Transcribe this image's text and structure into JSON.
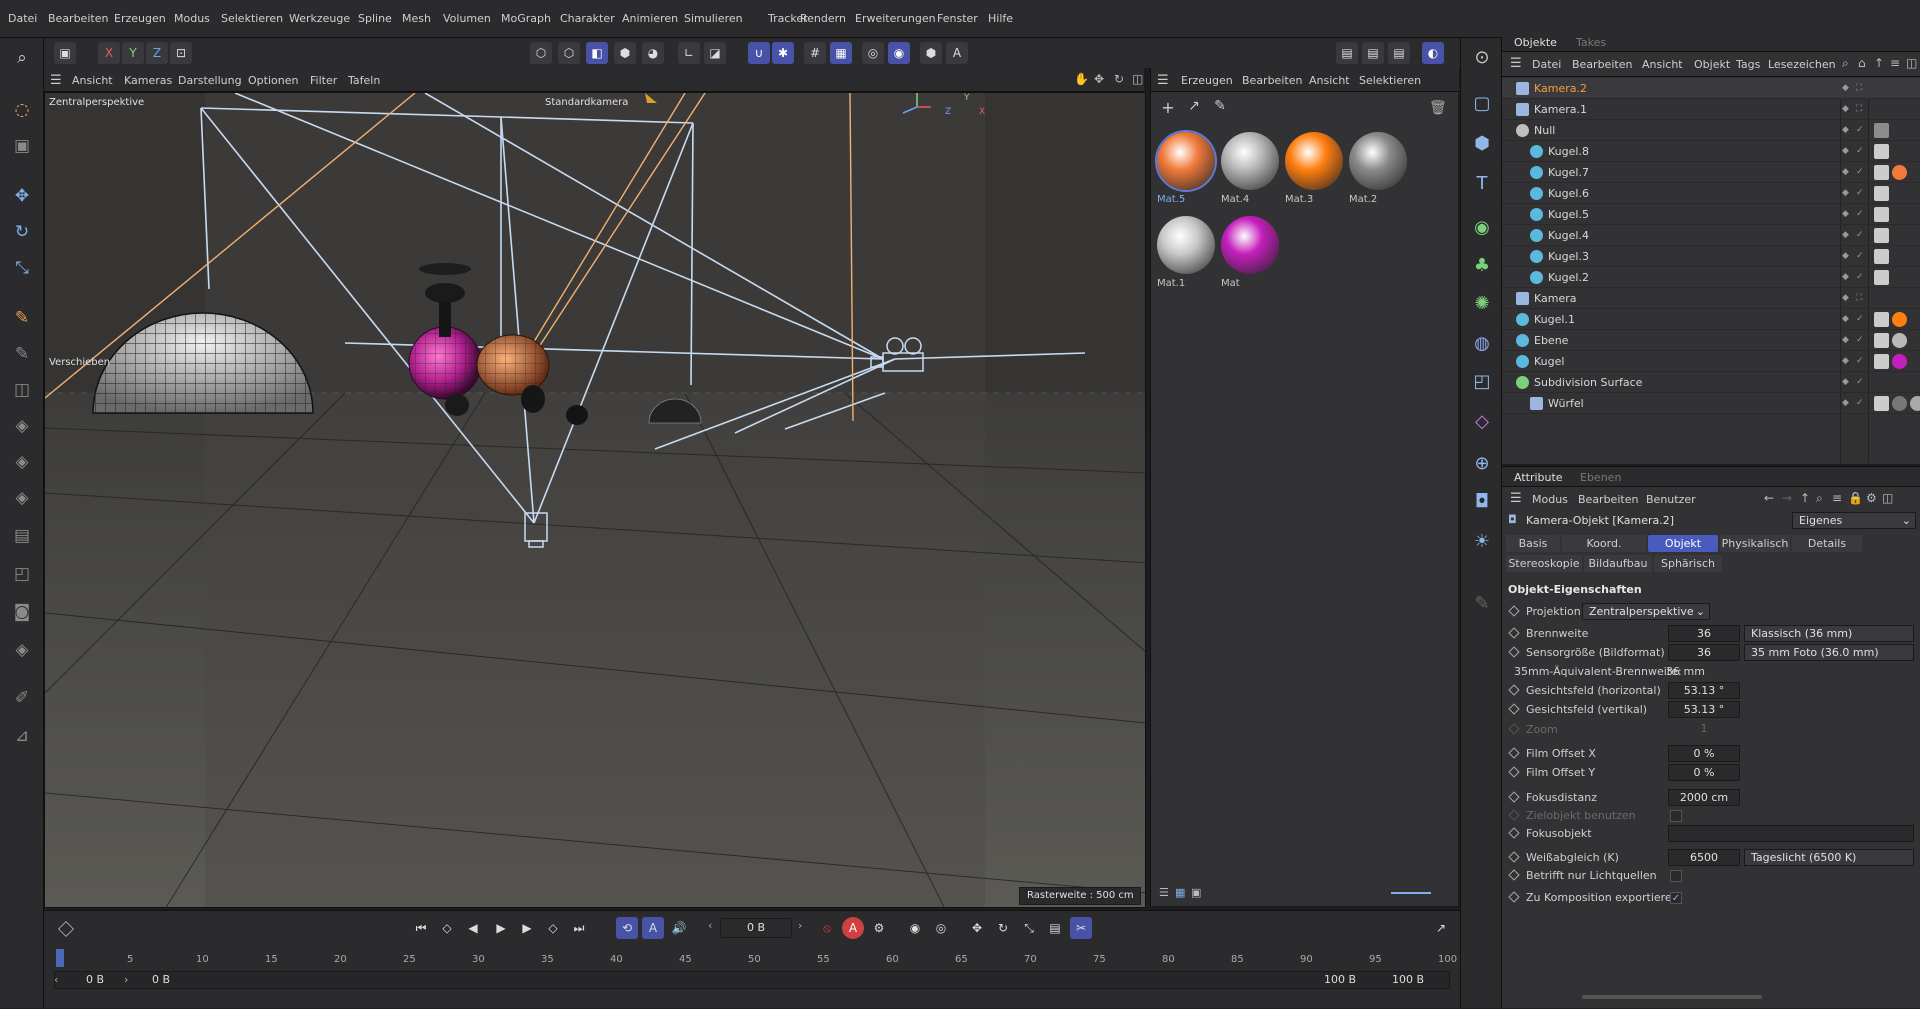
{
  "menubar": [
    "Datei",
    "Bearbeiten",
    "Erzeugen",
    "Modus",
    "Selektieren",
    "Werkzeuge",
    "Spline",
    "Mesh",
    "Volumen",
    "MoGraph",
    "Charakter",
    "Animieren",
    "Simulieren",
    "Tracker",
    "Rendern",
    "Erweiterungen",
    "Fenster",
    "Hilfe"
  ],
  "axis_buttons": [
    "X",
    "Y",
    "Z"
  ],
  "viewport": {
    "menu": [
      "Ansicht",
      "Kameras",
      "Darstellung",
      "Optionen",
      "Filter",
      "Tafeln"
    ],
    "projection_label": "Zentralperspektive",
    "camera_label": "Standardkamera",
    "tool_label": "Verschieben",
    "grid_label": "Rasterweite : 500 cm",
    "axis": {
      "x": "X",
      "y": "Y",
      "z": "Z"
    }
  },
  "materials": {
    "menu": [
      "Erzeugen",
      "Bearbeiten",
      "Ansicht",
      "Selektieren"
    ],
    "items": [
      {
        "name": "Mat.5",
        "color": "#f07a3a",
        "active": true
      },
      {
        "name": "Mat.4",
        "color": "#b8b8b8",
        "active": false
      },
      {
        "name": "Mat.3",
        "color": "#ff7e10",
        "active": false
      },
      {
        "name": "Mat.2",
        "color": "#8a8a8a",
        "active": false
      },
      {
        "name": "Mat.1",
        "color": "#c8c8c8",
        "active": false
      },
      {
        "name": "Mat",
        "color": "#c41fbc",
        "active": false
      }
    ]
  },
  "objects": {
    "tabs": [
      "Objekte",
      "Takes"
    ],
    "menu": [
      "Datei",
      "Bearbeiten",
      "Ansicht",
      "Objekt",
      "Tags",
      "Lesezeichen"
    ],
    "rows": [
      {
        "name": "Kamera.2",
        "indent": 0,
        "kind": "camera",
        "selected": true,
        "tags": []
      },
      {
        "name": "Kamera.1",
        "indent": 0,
        "kind": "camera",
        "selected": false,
        "tags": []
      },
      {
        "name": "Null",
        "indent": 0,
        "kind": "null",
        "selected": false,
        "tags": [
          "#8c8c8c"
        ]
      },
      {
        "name": "Kugel.8",
        "indent": 1,
        "kind": "sphere",
        "selected": false,
        "tags": [
          "#cccccc"
        ]
      },
      {
        "name": "Kugel.7",
        "indent": 1,
        "kind": "sphere",
        "selected": false,
        "tags": [
          "#cccccc",
          "#f07a3a"
        ]
      },
      {
        "name": "Kugel.6",
        "indent": 1,
        "kind": "sphere",
        "selected": false,
        "tags": [
          "#cccccc"
        ]
      },
      {
        "name": "Kugel.5",
        "indent": 1,
        "kind": "sphere",
        "selected": false,
        "tags": [
          "#cccccc"
        ]
      },
      {
        "name": "Kugel.4",
        "indent": 1,
        "kind": "sphere",
        "selected": false,
        "tags": [
          "#cccccc"
        ]
      },
      {
        "name": "Kugel.3",
        "indent": 1,
        "kind": "sphere",
        "selected": false,
        "tags": [
          "#cccccc"
        ]
      },
      {
        "name": "Kugel.2",
        "indent": 1,
        "kind": "sphere",
        "selected": false,
        "tags": [
          "#cccccc"
        ]
      },
      {
        "name": "Kamera",
        "indent": 0,
        "kind": "camera",
        "selected": false,
        "tags": []
      },
      {
        "name": "Kugel.1",
        "indent": 0,
        "kind": "sphere",
        "selected": false,
        "tags": [
          "#cccccc",
          "#ff7e10"
        ]
      },
      {
        "name": "Ebene",
        "indent": 0,
        "kind": "plane",
        "selected": false,
        "tags": [
          "#cccccc",
          "#b8b8b8"
        ]
      },
      {
        "name": "Kugel",
        "indent": 0,
        "kind": "sphere",
        "selected": false,
        "tags": [
          "#cccccc",
          "#c41fbc"
        ]
      },
      {
        "name": "Subdivision Surface",
        "indent": 0,
        "kind": "subdiv",
        "selected": false,
        "tags": []
      },
      {
        "name": "Würfel",
        "indent": 1,
        "kind": "cube",
        "selected": false,
        "tags": [
          "#cccccc",
          "#777777",
          "#aaaaaa"
        ]
      }
    ]
  },
  "attributes": {
    "tabs": [
      "Attribute",
      "Ebenen"
    ],
    "menu": [
      "Modus",
      "Bearbeiten",
      "Benutzer"
    ],
    "object_title": "Kamera-Objekt [Kamera.2]",
    "preset": "Eigenes",
    "tabs_row1": [
      "Basis",
      "Koord.",
      "Objekt",
      "Physikalisch",
      "Details"
    ],
    "active_tab": "Objekt",
    "tabs_row2": [
      "Stereoskopie",
      "Bildaufbau",
      "Sphärisch"
    ],
    "section": "Objekt-Eigenschaften",
    "projection_label": "Projektion",
    "projection_value": "Zentralperspektive",
    "fields": [
      {
        "label": "Brennweite",
        "value": "36",
        "extra": "Klassisch (36 mm)",
        "dim": false
      },
      {
        "label": "Sensorgröße (Bildformat)",
        "value": "36",
        "extra": "35 mm Foto (36.0 mm)",
        "dim": false
      },
      {
        "label": "35mm-Äquivalent-Brennweite:",
        "value": "36 mm",
        "extra": "",
        "dim": false,
        "plain": true
      },
      {
        "label": "Gesichtsfeld (horizontal)",
        "value": "53.13 °",
        "extra": "",
        "dim": false
      },
      {
        "label": "Gesichtsfeld (vertikal)",
        "value": "53.13 °",
        "extra": "",
        "dim": false
      },
      {
        "label": "Zoom",
        "value": "1",
        "extra": "",
        "dim": true
      },
      {
        "label": "Film Offset X",
        "value": "0 %",
        "extra": "",
        "dim": false
      },
      {
        "label": "Film Offset Y",
        "value": "0 %",
        "extra": "",
        "dim": false
      },
      {
        "label": "Fokusdistanz",
        "value": "2000 cm",
        "extra": "",
        "dim": false
      },
      {
        "label": "Zielobjekt benutzen",
        "value": "",
        "extra": "",
        "dim": true,
        "check": false
      },
      {
        "label": "Fokusobjekt",
        "value": "",
        "extra": "",
        "dim": false,
        "wide": true
      },
      {
        "label": "Weißabgleich (K)",
        "value": "6500",
        "extra": "Tageslicht (6500 K)",
        "dim": false
      },
      {
        "label": "Betrifft nur Lichtquellen",
        "value": "",
        "extra": "",
        "dim": false,
        "check": false
      },
      {
        "label": "Zu Komposition exportieren",
        "value": "",
        "extra": "",
        "dim": false,
        "check": true
      }
    ]
  },
  "timeline": {
    "frame": "0 B",
    "start": "0 B",
    "start2": "0 B",
    "end": "100 B",
    "end2": "100 B",
    "ticks": [
      "0",
      "5",
      "10",
      "15",
      "20",
      "25",
      "30",
      "35",
      "40",
      "45",
      "50",
      "55",
      "60",
      "65",
      "70",
      "75",
      "80",
      "85",
      "90",
      "95",
      "100"
    ]
  }
}
